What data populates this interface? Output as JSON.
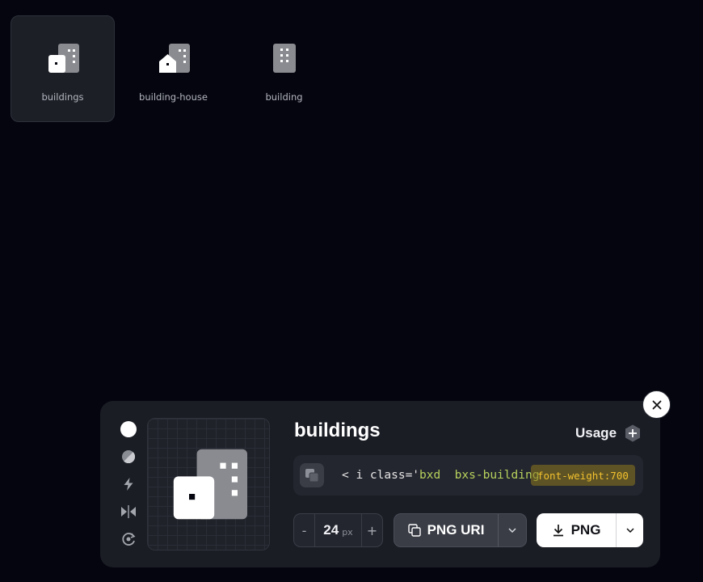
{
  "icons": [
    {
      "name": "buildings",
      "selected": true,
      "icon": "buildings-icon"
    },
    {
      "name": "building-house",
      "selected": false,
      "icon": "building-house-icon"
    },
    {
      "name": "building",
      "selected": false,
      "icon": "building-icon"
    }
  ],
  "panel": {
    "title": "buildings",
    "usage_label": "Usage",
    "code": {
      "open": "< i class='",
      "value": "bxd  bxs-building",
      "tooltip": "font-weight:700"
    },
    "size": {
      "value": "24",
      "unit": "px",
      "minus": "-",
      "plus": "+"
    },
    "copy_button": "PNG URI",
    "download_button": "PNG",
    "tools": [
      "solid-circle-icon",
      "half-tone-icon",
      "bolt-icon",
      "flip-icon",
      "rotate-icon"
    ]
  },
  "colors": {
    "background": "#04050e",
    "panel": "#1b1d25",
    "code_string": "#b6d15c",
    "tooltip_text": "#f2c12e",
    "icon_white": "#ffffff",
    "icon_grey": "#8a8b90"
  }
}
